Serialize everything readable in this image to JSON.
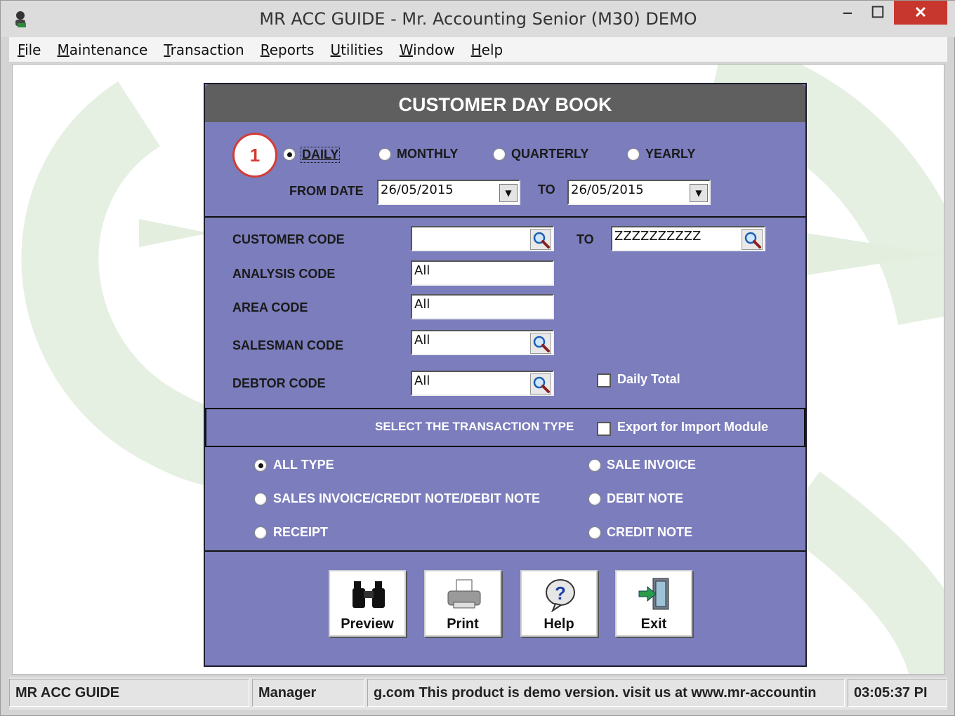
{
  "window": {
    "title": "MR ACC GUIDE - Mr. Accounting Senior (M30) DEMO",
    "close_label": "✕",
    "minimize_label": "‒",
    "maximize_label": "☐"
  },
  "menu": [
    {
      "label": "File",
      "key": "F"
    },
    {
      "label": "Maintenance",
      "key": "M"
    },
    {
      "label": "Transaction",
      "key": "T"
    },
    {
      "label": "Reports",
      "key": "R"
    },
    {
      "label": "Utilities",
      "key": "U"
    },
    {
      "label": "Window",
      "key": "W"
    },
    {
      "label": "Help",
      "key": "H"
    }
  ],
  "form": {
    "title": "CUSTOMER DAY BOOK",
    "period": {
      "options": [
        "DAILY",
        "MONTHLY",
        "QUARTERLY",
        "YEARLY"
      ],
      "selected": "DAILY"
    },
    "from_date_label": "FROM DATE",
    "from_date": "26/05/2015",
    "to_label": "TO",
    "to_date": "26/05/2015",
    "customer_code_label": "CUSTOMER CODE",
    "customer_code_from": "",
    "customer_to_label": "TO",
    "customer_code_to": "ZZZZZZZZZZ",
    "analysis_code_label": "ANALYSIS CODE",
    "analysis_code": "All",
    "area_code_label": "AREA CODE",
    "area_code": "All",
    "salesman_code_label": "SALESMAN CODE",
    "salesman_code": "All",
    "debtor_code_label": "DEBTOR CODE",
    "debtor_code": "All",
    "daily_total_label": "Daily Total",
    "daily_total_checked": false,
    "transaction_section_label": "SELECT THE TRANSACTION TYPE",
    "export_label": "Export for Import Module",
    "export_checked": false,
    "transaction_types": {
      "all": "ALL TYPE",
      "sales_combo": "SALES INVOICE/CREDIT NOTE/DEBIT NOTE",
      "receipt": "RECEIPT",
      "sale_invoice": "SALE INVOICE",
      "debit_note": "DEBIT NOTE",
      "credit_note": "CREDIT NOTE",
      "selected": "ALL TYPE"
    },
    "buttons": {
      "preview": "Preview",
      "print": "Print",
      "help": "Help",
      "exit": "Exit"
    }
  },
  "marker": "1",
  "status": {
    "app": "MR ACC GUIDE",
    "user": "Manager",
    "message": "g.com This product is demo version.  visit us at www.mr-accountin",
    "time": "03:05:37 PI"
  },
  "colors": {
    "form_bg": "#7b7dbc",
    "title_bg": "#5f5f5f",
    "close_bg": "#c7372d",
    "marker": "#d23d36"
  }
}
